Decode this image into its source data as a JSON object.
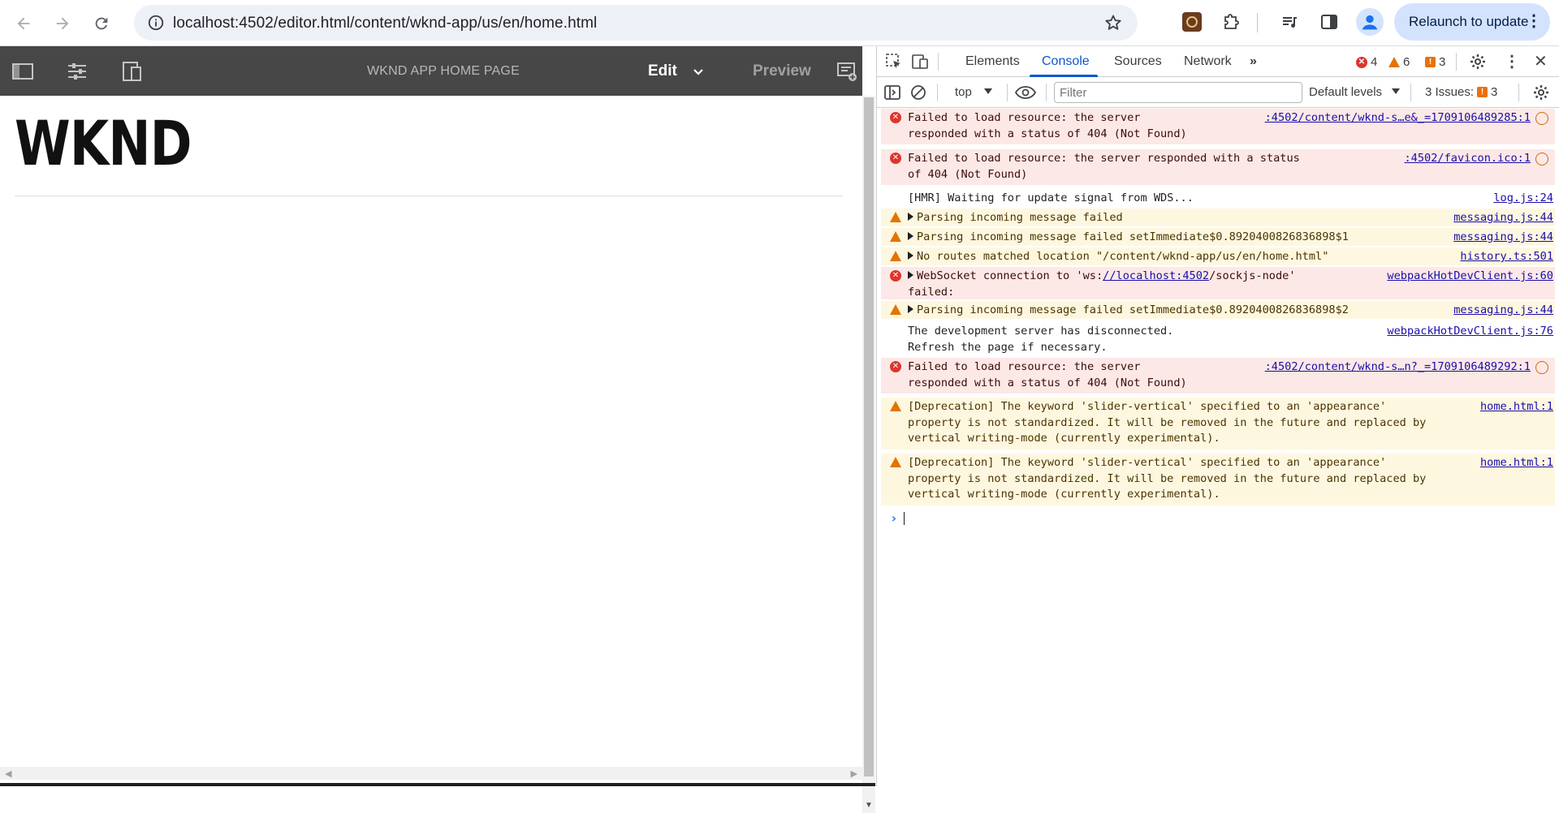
{
  "browser": {
    "url": "localhost:4502/editor.html/content/wknd-app/us/en/home.html",
    "relaunch_label": "Relaunch to update"
  },
  "aem": {
    "page_title": "WKND APP HOME PAGE",
    "edit_label": "Edit",
    "preview_label": "Preview"
  },
  "page": {
    "logo_text": "WKND"
  },
  "devtools": {
    "tabs": [
      "Elements",
      "Console",
      "Sources",
      "Network"
    ],
    "active_tab": "Console",
    "error_count": "4",
    "warning_count": "6",
    "issue_count": "3",
    "context": "top",
    "filter_placeholder": "Filter",
    "levels_label": "Default levels",
    "issues_label": "3 Issues:",
    "issues_badge": "3"
  },
  "console": {
    "messages": [
      {
        "level": "error",
        "line1": "Failed to load resource: the server",
        "line2": "responded with a status of 404 (Not Found)",
        "source": ":4502/content/wknd-s…e&_=1709106489285:1"
      },
      {
        "level": "error",
        "line1": "Failed to load resource: the server responded with a status",
        "line2": "of 404 (Not Found)",
        "source": ":4502/favicon.ico:1"
      },
      {
        "level": "info",
        "line1": "[HMR] Waiting for update signal from WDS...",
        "source": "log.js:24"
      },
      {
        "level": "warn",
        "line1": "Parsing incoming message failed",
        "source": "messaging.js:44"
      },
      {
        "level": "warn",
        "line1": "Parsing incoming message failed setImmediate$0.89204008268368​98$1",
        "source": "messaging.js:44"
      },
      {
        "level": "warn",
        "line1": "No routes matched location \"/content/wknd-app/us/en/home.html\"",
        "source": "history.ts:501"
      },
      {
        "level": "error",
        "line1_pre": "WebSocket connection to 'ws:",
        "line1_link": "//localhost:4502",
        "line1_post": "/sockjs-node'",
        "line2": "failed:",
        "source": "webpackHotDevClient.js:60"
      },
      {
        "level": "warn",
        "line1": "Parsing incoming message failed setImmediate$0.89204008268368​98$2",
        "source": "messaging.js:44"
      },
      {
        "level": "info",
        "line1": "The development server has disconnected.",
        "line2": "Refresh the page if necessary.",
        "source": "webpackHotDevClient.js:76"
      },
      {
        "level": "error",
        "line1": "Failed to load resource: the server",
        "line2": "responded with a status of 404 (Not Found)",
        "source": ":4502/content/wknd-s…n?_=1709106489292:1"
      },
      {
        "level": "warn",
        "line1": "[Deprecation] The keyword 'slider-vertical' specified to an 'appearance'",
        "line2": "property is not standardized. It will be removed in the future and replaced by",
        "line3": "vertical writing-mode (currently experimental).",
        "source": "home.html:1"
      },
      {
        "level": "warn",
        "line1": "[Deprecation] The keyword 'slider-vertical' specified to an 'appearance'",
        "line2": "property is not standardized. It will be removed in the future and replaced by",
        "line3": "vertical writing-mode (currently experimental).",
        "source": "home.html:1"
      }
    ]
  },
  "colors": {
    "aem_toolbar": "#474747",
    "devtools_accent": "#0b57d0",
    "error_bg": "#fce8e6",
    "warn_bg": "#fef7e0"
  }
}
